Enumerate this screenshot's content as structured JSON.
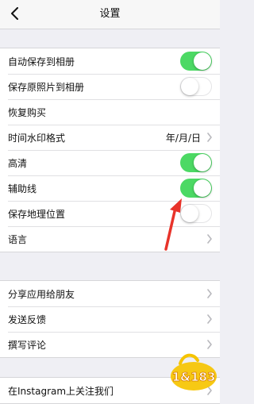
{
  "nav": {
    "title": "设置"
  },
  "groups": [
    {
      "rows": [
        {
          "label": "自动保存到相册",
          "control": "toggle",
          "on": true
        },
        {
          "label": "保存原照片到相册",
          "control": "toggle",
          "on": false
        },
        {
          "label": "恢复购买",
          "control": "none"
        },
        {
          "label": "时间水印格式",
          "control": "value",
          "value": "年/月/日"
        },
        {
          "label": "高清",
          "control": "toggle",
          "on": true
        },
        {
          "label": "辅助线",
          "control": "toggle",
          "on": true
        },
        {
          "label": "保存地理位置",
          "control": "toggle",
          "on": false
        },
        {
          "label": "语言",
          "control": "chevron"
        }
      ]
    },
    {
      "rows": [
        {
          "label": "分享应用给朋友",
          "control": "chevron"
        },
        {
          "label": "发送反馈",
          "control": "chevron"
        },
        {
          "label": "撰写评论",
          "control": "chevron"
        }
      ]
    },
    {
      "rows": [
        {
          "label": "在Instagram上关注我们",
          "control": "chevron"
        }
      ]
    }
  ],
  "watermark": {
    "text": "1&183"
  },
  "colors": {
    "toggle_on": "#4cd964",
    "annotation_arrow": "#e8332a",
    "background": "#efeff4"
  }
}
